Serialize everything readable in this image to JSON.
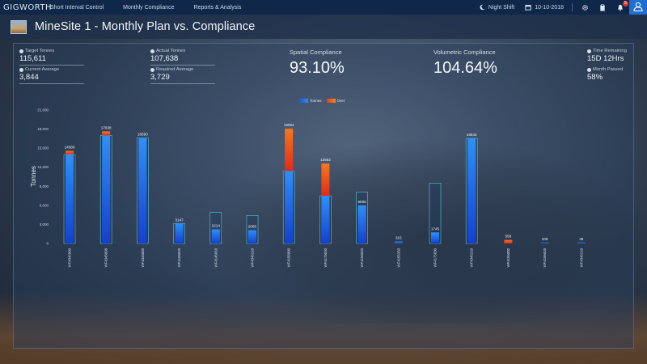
{
  "topbar": {
    "logo": "GIGWORTH",
    "nav": [
      "Short Interval Control",
      "Monthly Compliance",
      "Reports & Analysis"
    ],
    "shift": "Night Shift",
    "date": "10-10-2018",
    "notifications_count": "5"
  },
  "title": {
    "text": "MineSite 1 - Monthly Plan vs. Compliance"
  },
  "stats": {
    "target_tonnes_label": "Target Tonnes",
    "target_tonnes": "115,611",
    "current_average_label": "Current Average",
    "current_average": "3,844",
    "actual_tonnes_label": "Actual Tonnes",
    "actual_tonnes": "107,638",
    "required_average_label": "Required Average",
    "required_average": "3,729",
    "spatial_label": "Spatial Compliance",
    "spatial_value": "93.10%",
    "volumetric_label": "Volumetric Compliance",
    "volumetric_value": "104.64%",
    "time_remaining_label": "Time Remaining",
    "time_remaining": "15D 12Hrs",
    "month_passed_label": "Month Passed",
    "month_passed": "58%"
  },
  "chart_data": {
    "type": "bar",
    "ylabel": "Tonnes",
    "ylim": [
      0,
      21000
    ],
    "yticks": [
      "21,000",
      "18,000",
      "15,000",
      "12,000",
      "9,000",
      "6,000",
      "3,000",
      "0"
    ],
    "legend": [
      {
        "name": "Tonnes",
        "color": "#2a7cf0"
      },
      {
        "name": "Over",
        "color": "#f05a1a"
      }
    ],
    "categories": [
      "WF4345000",
      "WF4345008",
      "WF4345009",
      "WF4155020",
      "WF4145010",
      "WF4345210",
      "WF4155000",
      "WF4175030",
      "WF4155020",
      "WF4155350",
      "WF4175030",
      "WF4345210",
      "WF4155000",
      "WF4155020",
      "WF4345210"
    ],
    "labels": [
      "14580",
      "17638",
      "16590",
      "3147",
      "2214",
      "2085",
      "18054",
      "12582",
      "6000",
      "315",
      "1745",
      "16542",
      "558",
      "108",
      "38"
    ],
    "plan": [
      14000,
      17000,
      16590,
      3147,
      4900,
      4400,
      11400,
      7500,
      8100,
      0,
      9500,
      16542,
      0,
      0,
      0
    ],
    "tonnes": [
      14000,
      17000,
      16590,
      3147,
      2214,
      2085,
      11400,
      7500,
      6000,
      315,
      1745,
      16542,
      0,
      108,
      38
    ],
    "over": [
      580,
      638,
      0,
      0,
      0,
      0,
      6654,
      5082,
      0,
      0,
      0,
      0,
      558,
      0,
      0
    ]
  },
  "colors": {
    "topbar": "#0f2748",
    "accent": "#1f6fd0",
    "bar_blue": "#2a7cf0",
    "bar_orange": "#f05a1a"
  },
  "icons": [
    "moon-icon",
    "calendar-icon",
    "gear-icon",
    "clipboard-icon",
    "bell-icon",
    "user-icon"
  ]
}
